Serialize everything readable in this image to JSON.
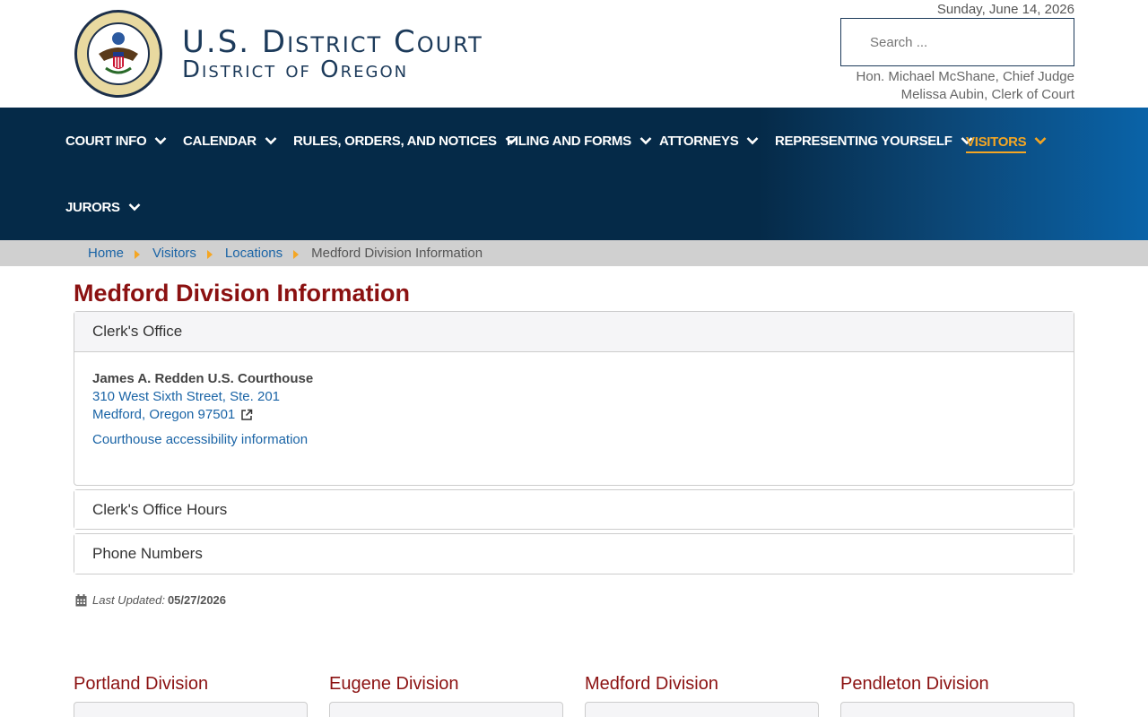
{
  "header": {
    "court_line1": "U.S. District Court",
    "court_line2": "District of Oregon",
    "date": "Sunday, June 14, 2026",
    "search_placeholder": "Search ...",
    "chief_judge": "Hon. Michael McShane, Chief Judge",
    "clerk": "Melissa Aubin, Clerk of Court",
    "seal_text_top": "UNITED STATES DISTRICT COURT",
    "seal_text_bottom": "DISTRICT OF OREGON"
  },
  "nav": {
    "items": [
      {
        "label": "COURT INFO"
      },
      {
        "label": "CALENDAR"
      },
      {
        "label": "RULES, ORDERS, AND NOTICES"
      },
      {
        "label": "FILING AND FORMS"
      },
      {
        "label": "ATTORNEYS"
      },
      {
        "label": "REPRESENTING YOURSELF"
      },
      {
        "label": "VISITORS"
      },
      {
        "label": "JURORS"
      }
    ],
    "active": "VISITORS",
    "active_color": "#f5a623"
  },
  "breadcrumb": {
    "items": [
      "Home",
      "Visitors",
      "Locations"
    ],
    "current": "Medford Division Information"
  },
  "main": {
    "title": "Medford Division Information",
    "panels": [
      {
        "heading": "Clerk's Office",
        "building": "James A. Redden U.S. Courthouse",
        "address1": "310 West Sixth Street, Ste. 201",
        "address2": "Medford, Oregon 97501",
        "link": "Courthouse accessibility information"
      },
      {
        "heading": "Clerk's Office Hours"
      },
      {
        "heading": "Phone Numbers"
      }
    ],
    "last_updated_label": "Last Updated:",
    "last_updated_value": "05/27/2026"
  },
  "divisions": [
    "Portland Division",
    "Eugene Division",
    "Medford Division",
    "Pendleton Division"
  ],
  "colors": {
    "nav_bg": "#052a48",
    "title_red": "#8b1111",
    "link_blue": "#1a64a6",
    "accent": "#f5a623"
  }
}
